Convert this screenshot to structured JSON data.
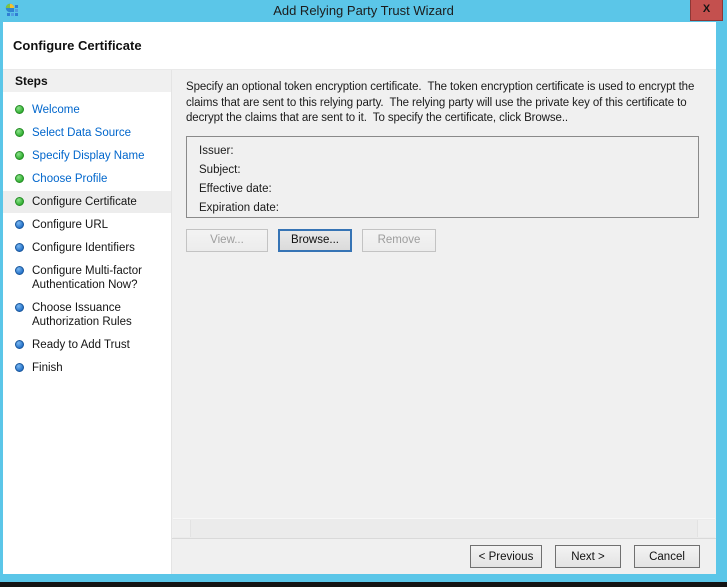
{
  "window": {
    "title": "Add Relying Party Trust Wizard",
    "close_label": "X"
  },
  "header": {
    "title": "Configure Certificate"
  },
  "sidebar": {
    "title": "Steps",
    "steps": [
      {
        "label": "Welcome",
        "status": "completed"
      },
      {
        "label": "Select Data Source",
        "status": "completed"
      },
      {
        "label": "Specify Display Name",
        "status": "completed"
      },
      {
        "label": "Choose Profile",
        "status": "completed"
      },
      {
        "label": "Configure Certificate",
        "status": "current"
      },
      {
        "label": "Configure URL",
        "status": "upcoming"
      },
      {
        "label": "Configure Identifiers",
        "status": "upcoming"
      },
      {
        "label": "Configure Multi-factor Authentication Now?",
        "status": "upcoming"
      },
      {
        "label": "Choose Issuance Authorization Rules",
        "status": "upcoming"
      },
      {
        "label": "Ready to Add Trust",
        "status": "upcoming"
      },
      {
        "label": "Finish",
        "status": "upcoming"
      }
    ]
  },
  "content": {
    "description": "Specify an optional token encryption certificate.  The token encryption certificate is used to encrypt the claims that are sent to this relying party.  The relying party will use the private key of this certificate to decrypt the claims that are sent to it.  To specify the certificate, click Browse..",
    "certificate_fields": [
      {
        "label": "Issuer:",
        "value": ""
      },
      {
        "label": "Subject:",
        "value": ""
      },
      {
        "label": "Effective date:",
        "value": ""
      },
      {
        "label": "Expiration date:",
        "value": ""
      }
    ],
    "buttons": [
      {
        "label": "View...",
        "enabled": false
      },
      {
        "label": "Browse...",
        "enabled": true,
        "focused": true
      },
      {
        "label": "Remove",
        "enabled": false
      }
    ]
  },
  "footer": {
    "buttons": [
      {
        "label": "< Previous"
      },
      {
        "label": "Next >"
      },
      {
        "label": "Cancel"
      }
    ]
  },
  "colors": {
    "titlebar": "#5bc6e8",
    "close_button": "#c4504e",
    "link_blue": "#0066cc",
    "completed_dot": "#2fae2f",
    "upcoming_dot": "#2270c8",
    "content_bg": "#f0f0f0",
    "focus_border": "#3674b5"
  }
}
